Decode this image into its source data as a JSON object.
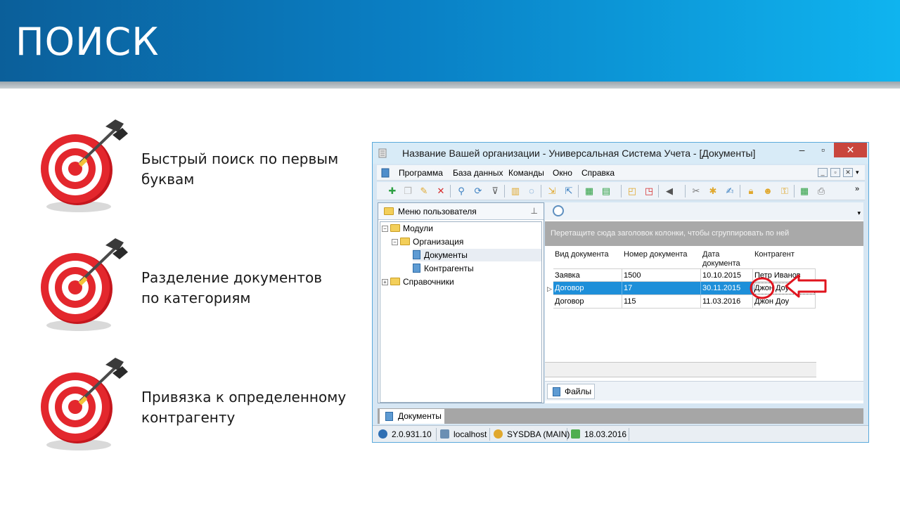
{
  "slide": {
    "title": "ПОИСК",
    "features": [
      {
        "line1": "Быстрый поиск по первым",
        "line2": "буквам"
      },
      {
        "line1": "Разделение документов",
        "line2": "по категориям"
      },
      {
        "line1": "Привязка к определенному",
        "line2": "контрагенту"
      }
    ]
  },
  "window": {
    "title": "Название Вашей организации - Универсальная Система Учета - [Документы]",
    "menu": [
      "Программа",
      "База данных",
      "Команды",
      "Окно",
      "Справка"
    ],
    "left_panel": {
      "header": "Меню пользователя",
      "tree": [
        "Модули",
        "Организация",
        "Документы",
        "Контрагенты",
        "Справочники"
      ]
    },
    "grid": {
      "group_hint": "Перетащите сюда заголовок колонки, чтобы сгруппировать по ней",
      "columns": [
        "Вид документа",
        "Номер документа",
        "Дата документа",
        "Контрагент"
      ],
      "rows": [
        {
          "type": "Заявка",
          "number": "1500",
          "date": "10.10.2015",
          "party": "Петр Иванов"
        },
        {
          "type": "Договор",
          "number": "17",
          "date": "30.11.2015",
          "party": "Джон Доу"
        },
        {
          "type": "Договор",
          "number": "115",
          "date": "11.03.2016",
          "party": "Джон Доу"
        }
      ],
      "selected_row": 1
    },
    "files_tab": "Файлы",
    "bottom_tab": "Документы",
    "status": {
      "version": "2.0.931.10",
      "host": "localhost",
      "user": "SYSDBA (MAIN)",
      "date": "18.03.2016"
    }
  },
  "colors": {
    "accent": "#0a7fc4",
    "selection": "#1e8fd9",
    "annotation": "#e0141e"
  }
}
